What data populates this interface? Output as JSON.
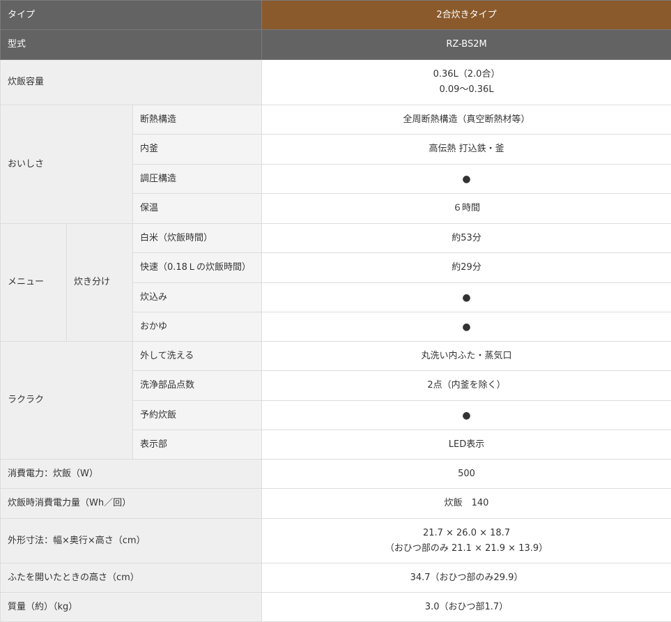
{
  "colors": {
    "header_gray": "#636363",
    "header_brown": "#8a5a2c",
    "label_bg": "#efefef",
    "border": "#dcdcdc"
  },
  "header": {
    "type_label": "タイプ",
    "type_value": "2合炊きタイプ",
    "model_label": "型式",
    "model_value": "RZ-BS2M"
  },
  "capacity": {
    "label": "炊飯容量",
    "value_line1": "0.36L（2.0合）",
    "value_line2": "0.09～0.36L"
  },
  "oishisa": {
    "label": "おいしさ",
    "rows": [
      {
        "label": "断熱構造",
        "value": "全周断熱構造（真空断熱材等）"
      },
      {
        "label": "内釜",
        "value": "高伝熱 打込鉄・釜"
      },
      {
        "label": "調圧構造",
        "value": "●"
      },
      {
        "label": "保温",
        "value": "６時間"
      }
    ]
  },
  "menu": {
    "label": "メニュー",
    "sub_label": "炊き分け",
    "rows": [
      {
        "label": "白米（炊飯時間）",
        "value": "約53分"
      },
      {
        "label": "快速（0.18Ｌの炊飯時間）",
        "value": "約29分"
      },
      {
        "label": "炊込み",
        "value": "●"
      },
      {
        "label": "おかゆ",
        "value": "●"
      }
    ]
  },
  "rakuraku": {
    "label": "ラクラク",
    "rows": [
      {
        "label": "外して洗える",
        "value": "丸洗い内ふた・蒸気口"
      },
      {
        "label": "洗浄部品点数",
        "value": "2点（内釜を除く）"
      },
      {
        "label": "予約炊飯",
        "value": "●"
      },
      {
        "label": "表示部",
        "value": "LED表示"
      }
    ]
  },
  "specs": {
    "power_label": "消費電力：炊飯（W）",
    "power_value": "500",
    "energy_label": "炊飯時消費電力量（Wh／回）",
    "energy_value": "炊飯　140",
    "size_label": "外形寸法：幅×奥行×高さ（cm）",
    "size_line1": "21.7 × 26.0 × 18.7",
    "size_line2": "（おひつ部のみ 21.1 × 21.9 × 13.9）",
    "lid_label": "ふたを開いたときの高さ（cm）",
    "lid_value": "34.7（おひつ部のみ29.9）",
    "weight_label": "質量（約）（kg）",
    "weight_value": "3.0（おひつ部1.7）"
  }
}
